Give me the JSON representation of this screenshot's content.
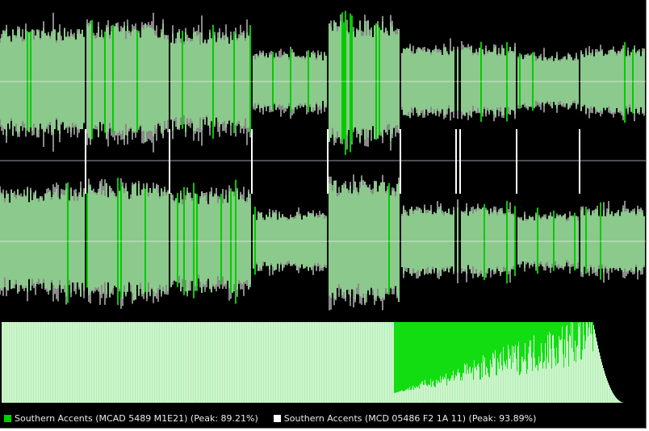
{
  "colors": {
    "background": "#000000",
    "track_a": "#00cc00",
    "track_b": "#ffffff",
    "waveform_overlap": "#8cc98c",
    "waveform_b_only": "#8a8a8a",
    "peak_track_a": "#11dd11",
    "peak_track_b": "#ccf5cc",
    "separator_line": "#ffffff",
    "center_line": "#ffffff"
  },
  "legend": {
    "items": [
      {
        "label": "Southern Accents (MCAD 5489 M1E21) (Peak: 89.21%)",
        "color": "#00cc00"
      },
      {
        "label": "Southern Accents (MCD 05486 F2 1A 11) (Peak: 93.89%)",
        "color": "#ffffff"
      }
    ]
  },
  "waveform": {
    "channels": [
      "left",
      "right"
    ],
    "track_boundaries": [
      0.132,
      0.262,
      0.39,
      0.508,
      0.62,
      0.706,
      0.713,
      0.8,
      0.897
    ],
    "segments": [
      {
        "amplitude": 0.7
      },
      {
        "amplitude": 0.76
      },
      {
        "amplitude": 0.66
      },
      {
        "amplitude": 0.38
      },
      {
        "amplitude": 0.8
      },
      {
        "amplitude": 0.46
      },
      {
        "amplitude": 0.48
      },
      {
        "amplitude": 0.46
      },
      {
        "amplitude": 0.36
      },
      {
        "amplitude": 0.44
      }
    ]
  },
  "peak_distribution": {
    "track_a_extends_to": 0.61,
    "track_b_fall_start": 0.92,
    "track_b_end": 0.97
  }
}
